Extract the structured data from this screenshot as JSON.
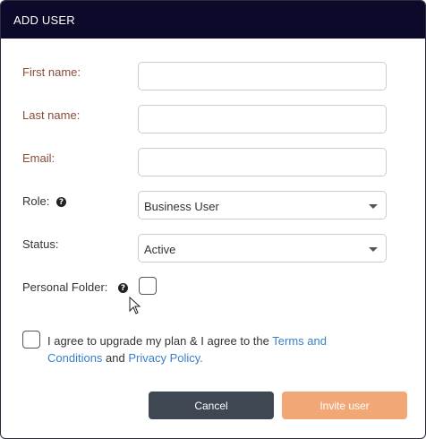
{
  "header": {
    "title": "ADD USER"
  },
  "form": {
    "first_name": {
      "label": "First name:",
      "value": ""
    },
    "last_name": {
      "label": "Last name:",
      "value": ""
    },
    "email": {
      "label": "Email:",
      "value": ""
    },
    "role": {
      "label": "Role:",
      "value": "Business User"
    },
    "status": {
      "label": "Status:",
      "value": "Active"
    },
    "personal_folder": {
      "label": "Personal Folder:",
      "checked": false
    }
  },
  "agreement": {
    "text_start": "I agree to upgrade my plan & I agree to the ",
    "terms_link": "Terms and Conditions",
    "text_mid": " and ",
    "privacy_link": "Privacy Policy.",
    "checked": false
  },
  "buttons": {
    "cancel": "Cancel",
    "invite": "Invite user"
  },
  "icons": {
    "help": "help-icon",
    "cursor": "mouse-pointer-icon",
    "caret": "chevron-down-icon"
  },
  "colors": {
    "header_bg": "#0b0a2a",
    "cancel_bg": "#3f4752",
    "invite_bg": "#f2a876",
    "link": "#3a7fc8",
    "required_label": "#8a4a3a"
  }
}
